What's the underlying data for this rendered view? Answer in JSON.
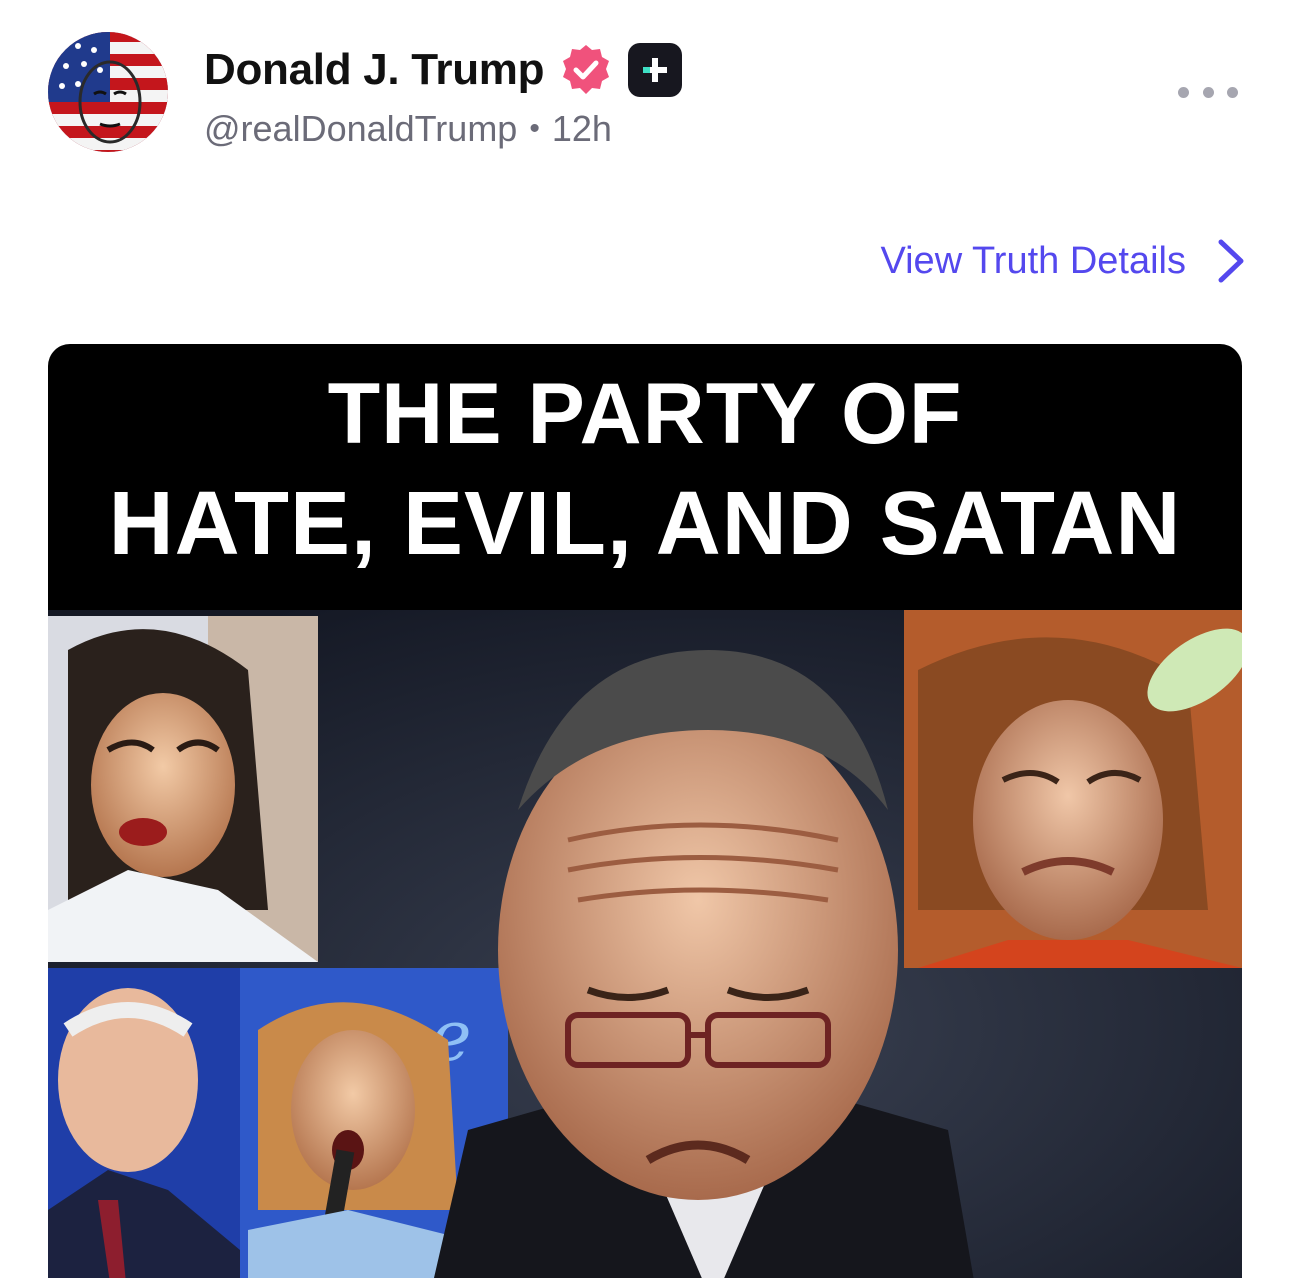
{
  "post": {
    "author": {
      "display_name": "Donald J. Trump",
      "handle": "@realDonaldTrump",
      "verified_icon": "verified-badge-icon",
      "plus_icon": "truth-plus-icon"
    },
    "timestamp": "12h",
    "separator": "•",
    "more_icon": "more-horizontal-icon",
    "view_details": {
      "label": "View Truth Details",
      "icon": "chevron-right-icon"
    },
    "media": {
      "caption_line1": "THE PARTY OF",
      "caption_line2": "HATE, EVIL, AND SATAN",
      "overlay_text": "oe"
    }
  },
  "colors": {
    "accent": "#5448ee",
    "verified": "#f0527c",
    "name": "#111111",
    "muted": "#6b6b78",
    "media_bg": "#000000"
  }
}
